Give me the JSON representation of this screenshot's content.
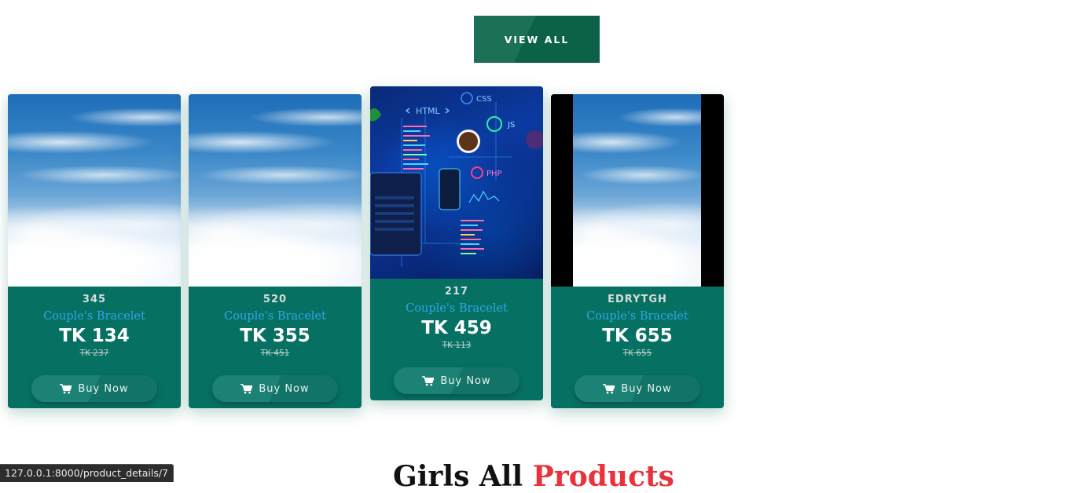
{
  "view_all": {
    "label": "VIEW ALL"
  },
  "products": [
    {
      "code": "345",
      "name": "Couple's Bracelet",
      "price": "TK 134",
      "old_price": "TK 237",
      "image": "sky-clouds",
      "button": "Buy Now"
    },
    {
      "code": "520",
      "name": "Couple's Bracelet",
      "price": "TK 355",
      "old_price": "TK 451",
      "image": "sky-clouds",
      "button": "Buy Now"
    },
    {
      "code": "217",
      "name": "Couple's Bracelet",
      "price": "TK 459",
      "old_price": "TK 113",
      "image": "web-dev-illustration",
      "button": "Buy Now"
    },
    {
      "code": "EDRYTGH",
      "name": "Couple's Bracelet",
      "price": "TK 655",
      "old_price": "TK 655",
      "image": "sky-clouds-letterboxed",
      "button": "Buy Now"
    }
  ],
  "section": {
    "title_part1": "Girls All ",
    "title_part2": "Products"
  },
  "status_bar": {
    "url": "127.0.0.1:8000/product_details/7"
  },
  "colors": {
    "card": "#067163",
    "button": "#0b6248",
    "accent": "#e8323c",
    "product_name": "#2fa6e6"
  },
  "tech_labels": [
    "HTML",
    "CSS",
    "JS",
    "PHP"
  ]
}
